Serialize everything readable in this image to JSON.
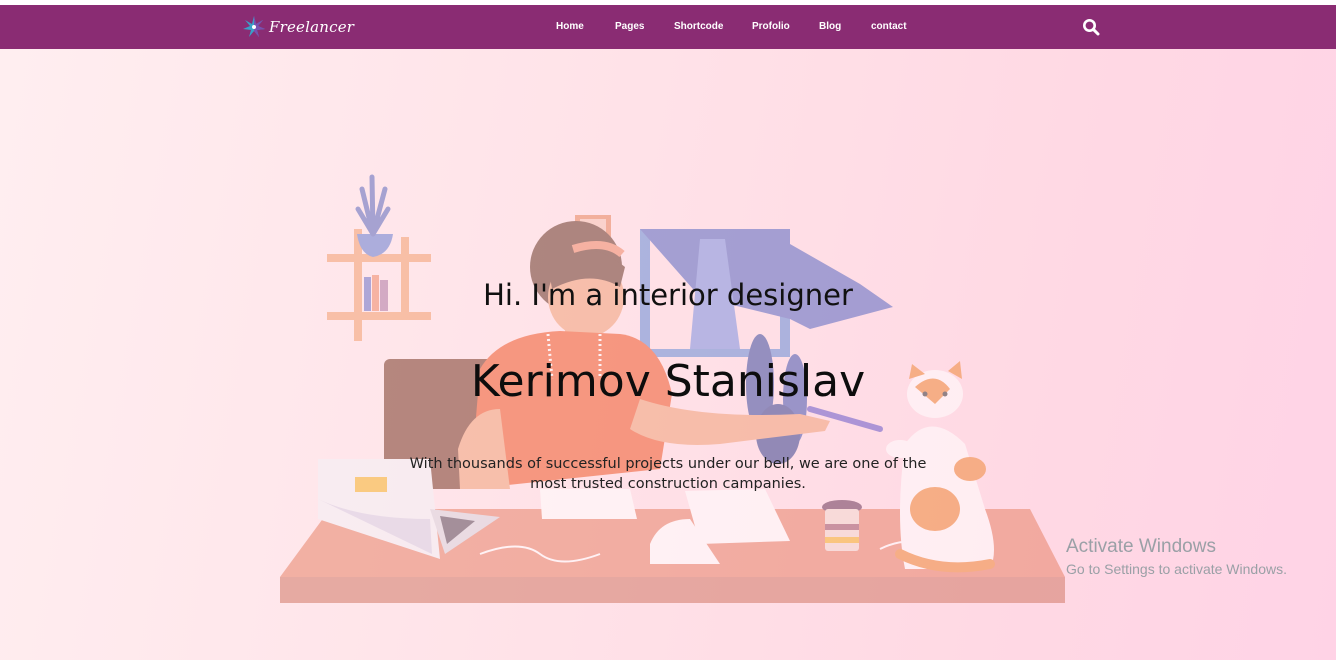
{
  "brand": {
    "name": "Freelancer",
    "logo_icon": "star-burst-icon",
    "colors": {
      "navbar": "#8a2c73",
      "logo_star_left": "#3aa0c8",
      "logo_star_right": "#7a4fb0"
    }
  },
  "nav": {
    "items": [
      {
        "label": "Home"
      },
      {
        "label": "Pages"
      },
      {
        "label": "Shortcode"
      },
      {
        "label": "Profolio"
      },
      {
        "label": "Blog"
      },
      {
        "label": "contact"
      }
    ],
    "search_icon": "search-icon"
  },
  "hero": {
    "subtitle": "Hi. I'm a interior designer",
    "name": "Kerimov Stanislav",
    "description": "With thousands of successful projects under our bell, we are one of the most trusted construction campanies.",
    "background_illustration": "designer-at-desk-with-cat-illustration"
  },
  "overlay": {
    "title": "Activate Windows",
    "subtitle": "Go to Settings to activate Windows."
  }
}
